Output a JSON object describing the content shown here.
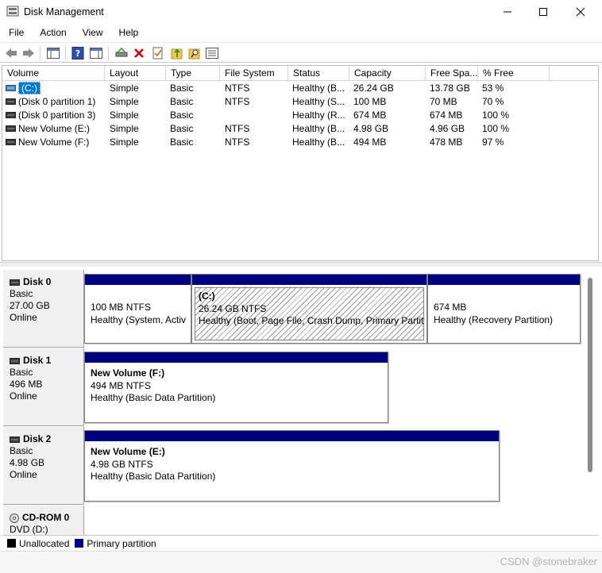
{
  "window": {
    "title": "Disk Management"
  },
  "menu": [
    "File",
    "Action",
    "View",
    "Help"
  ],
  "volume_list": {
    "columns": [
      "Volume",
      "Layout",
      "Type",
      "File System",
      "Status",
      "Capacity",
      "Free Spa...",
      "% Free"
    ],
    "rows": [
      {
        "volume": "(C:)",
        "layout": "Simple",
        "type": "Basic",
        "fs": "NTFS",
        "status": "Healthy (B...",
        "capacity": "26.24 GB",
        "free": "13.78 GB",
        "pct": "53 %",
        "selected": true
      },
      {
        "volume": "(Disk 0 partition 1)",
        "layout": "Simple",
        "type": "Basic",
        "fs": "NTFS",
        "status": "Healthy (S...",
        "capacity": "100 MB",
        "free": "70 MB",
        "pct": "70 %"
      },
      {
        "volume": "(Disk 0 partition 3)",
        "layout": "Simple",
        "type": "Basic",
        "fs": "",
        "status": "Healthy (R...",
        "capacity": "674 MB",
        "free": "674 MB",
        "pct": "100 %"
      },
      {
        "volume": "New Volume (E:)",
        "layout": "Simple",
        "type": "Basic",
        "fs": "NTFS",
        "status": "Healthy (B...",
        "capacity": "4.98 GB",
        "free": "4.96 GB",
        "pct": "100 %"
      },
      {
        "volume": "New Volume (F:)",
        "layout": "Simple",
        "type": "Basic",
        "fs": "NTFS",
        "status": "Healthy (B...",
        "capacity": "494 MB",
        "free": "478 MB",
        "pct": "97 %"
      }
    ]
  },
  "disks": [
    {
      "name": "Disk 0",
      "type": "Basic",
      "size": "27.00 GB",
      "status": "Online",
      "partitions": [
        {
          "title": "",
          "size": "100 MB NTFS",
          "status": "Healthy (System, Activ"
        },
        {
          "title": "(C:)",
          "size": "26.24 GB NTFS",
          "status": "Healthy (Boot, Page File, Crash Dump, Primary Partitic"
        },
        {
          "title": "",
          "size": "674 MB",
          "status": "Healthy (Recovery Partition)"
        }
      ]
    },
    {
      "name": "Disk 1",
      "type": "Basic",
      "size": "496 MB",
      "status": "Online",
      "partitions": [
        {
          "title": "New Volume  (F:)",
          "size": "494 MB NTFS",
          "status": "Healthy (Basic Data Partition)"
        }
      ]
    },
    {
      "name": "Disk 2",
      "type": "Basic",
      "size": "4.98 GB",
      "status": "Online",
      "partitions": [
        {
          "title": "New Volume  (E:)",
          "size": "4.98 GB NTFS",
          "status": "Healthy (Basic Data Partition)"
        }
      ]
    },
    {
      "name": "CD-ROM 0",
      "type": "DVD (D:)"
    }
  ],
  "legend": {
    "unallocated": "Unallocated",
    "primary": "Primary partition",
    "colors": {
      "unallocated": "#000000",
      "primary": "#00007f"
    }
  },
  "watermark": "CSDN @stonebraker",
  "colors": {
    "selection": "#0078d7",
    "partition_bar": "#00007f"
  }
}
